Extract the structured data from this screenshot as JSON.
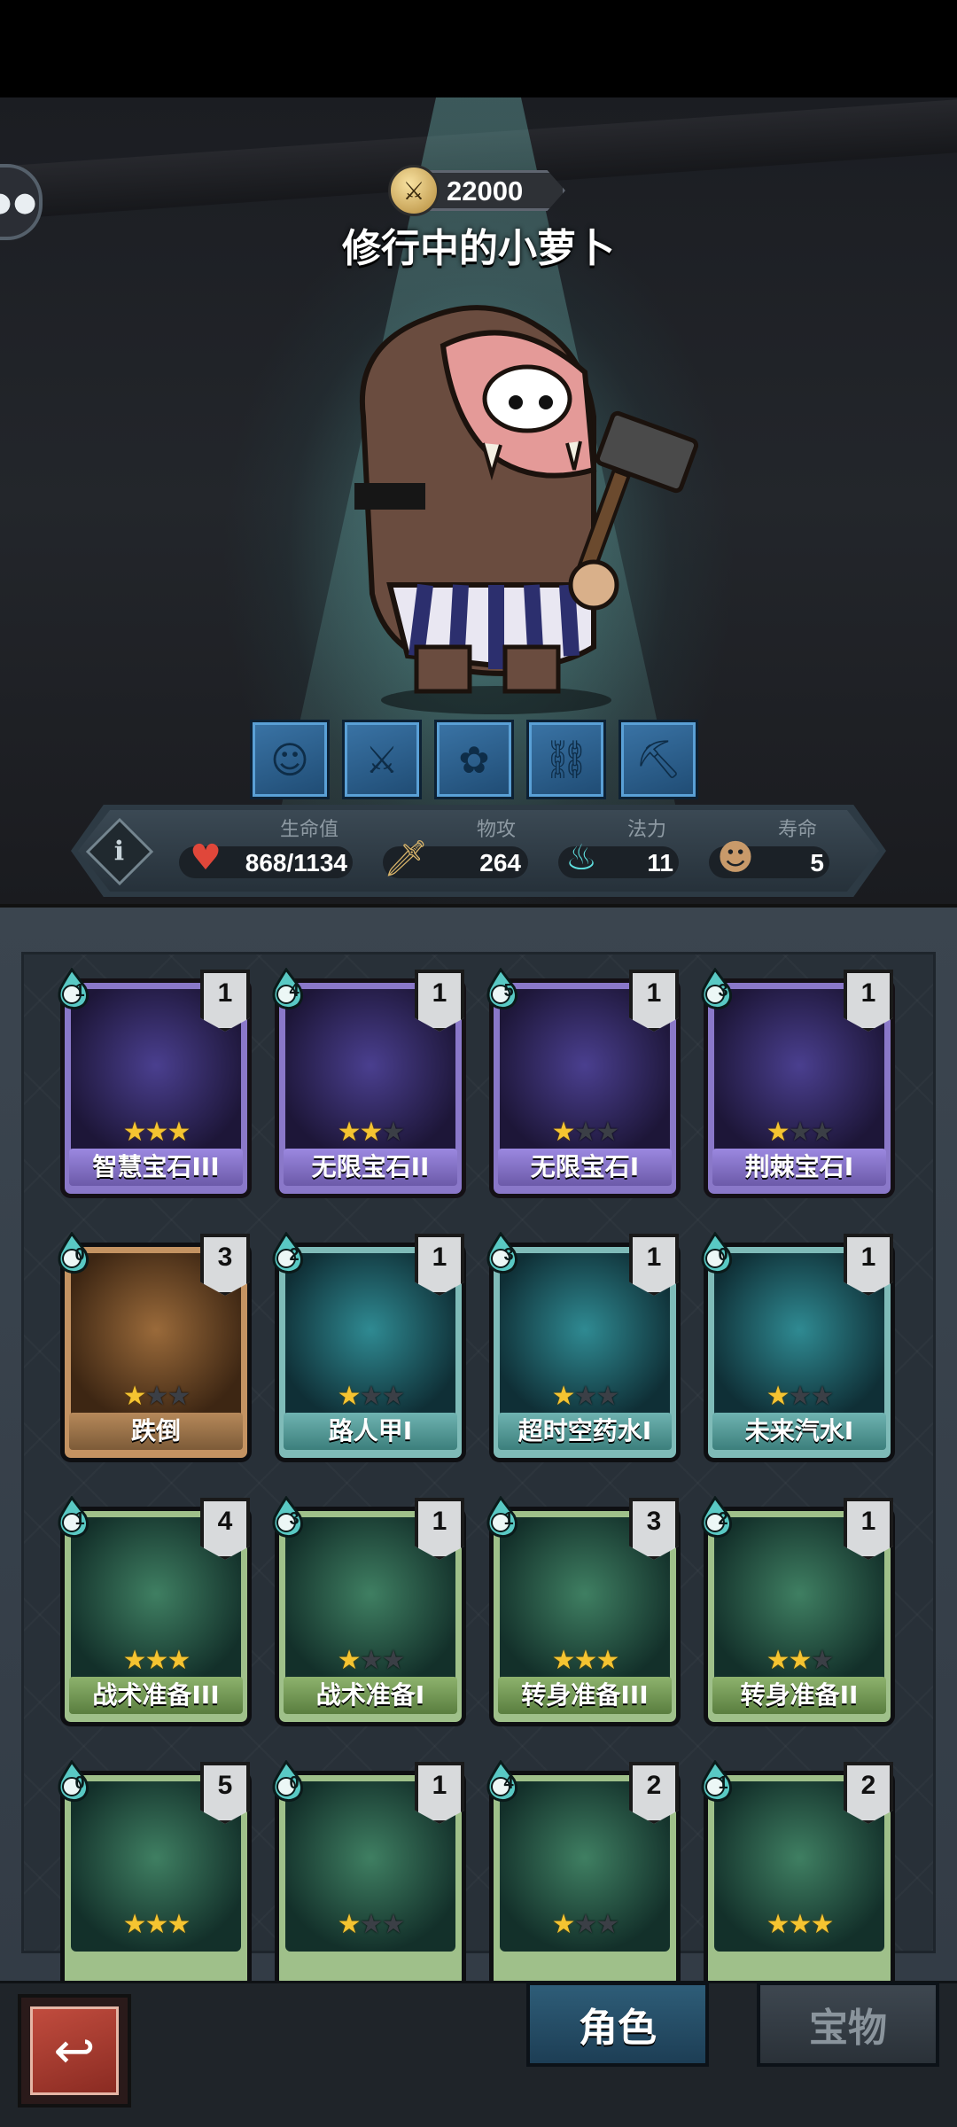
{
  "hero": {
    "power": "22000",
    "name": "修行中的小萝卜",
    "skills": [
      "bear-face-icon",
      "sword-icon",
      "beast-icon",
      "chain-icon",
      "pickaxe-icon"
    ]
  },
  "stats": {
    "hp": {
      "label": "生命值",
      "value": "868/1134",
      "icon": "heart-icon"
    },
    "attack": {
      "label": "物攻",
      "value": "264",
      "icon": "sword-icon"
    },
    "mana": {
      "label": "法力",
      "value": "11",
      "icon": "flame-icon"
    },
    "life": {
      "label": "寿命",
      "value": "5",
      "icon": "head-icon"
    }
  },
  "cards": [
    {
      "name": "智慧宝石III",
      "cost": "1",
      "count": "1",
      "stars": 3,
      "theme": "purple"
    },
    {
      "name": "无限宝石II",
      "cost": "4",
      "count": "1",
      "stars": 2,
      "theme": "purple"
    },
    {
      "name": "无限宝石I",
      "cost": "5",
      "count": "1",
      "stars": 1,
      "theme": "purple"
    },
    {
      "name": "荆棘宝石I",
      "cost": "3",
      "count": "1",
      "stars": 1,
      "theme": "purple"
    },
    {
      "name": "跌倒",
      "cost": "0",
      "count": "3",
      "stars": 1,
      "theme": "brown"
    },
    {
      "name": "路人甲I",
      "cost": "2",
      "count": "1",
      "stars": 1,
      "theme": "teal"
    },
    {
      "name": "超时空药水I",
      "cost": "3",
      "count": "1",
      "stars": 1,
      "theme": "teal"
    },
    {
      "name": "未来汽水I",
      "cost": "0",
      "count": "1",
      "stars": 1,
      "theme": "teal"
    },
    {
      "name": "战术准备III",
      "cost": "1",
      "count": "4",
      "stars": 3,
      "theme": "green"
    },
    {
      "name": "战术准备I",
      "cost": "3",
      "count": "1",
      "stars": 1,
      "theme": "green"
    },
    {
      "name": "转身准备III",
      "cost": "1",
      "count": "3",
      "stars": 3,
      "theme": "green"
    },
    {
      "name": "转身准备II",
      "cost": "2",
      "count": "1",
      "stars": 2,
      "theme": "green"
    },
    {
      "name": "",
      "cost": "0",
      "count": "5",
      "stars": 3,
      "theme": "green"
    },
    {
      "name": "",
      "cost": "0",
      "count": "1",
      "stars": 1,
      "theme": "green"
    },
    {
      "name": "",
      "cost": "4",
      "count": "2",
      "stars": 1,
      "theme": "green"
    },
    {
      "name": "",
      "cost": "1",
      "count": "2",
      "stars": 3,
      "theme": "green"
    }
  ],
  "tabs": {
    "role": "角色",
    "treasure": "宝物"
  },
  "colors": {
    "purple_frame": "#8a78c9",
    "brown_frame": "#c49362",
    "teal_frame": "#7fbbb8",
    "green_frame": "#9fc08a",
    "star_on": "#f5c431"
  }
}
